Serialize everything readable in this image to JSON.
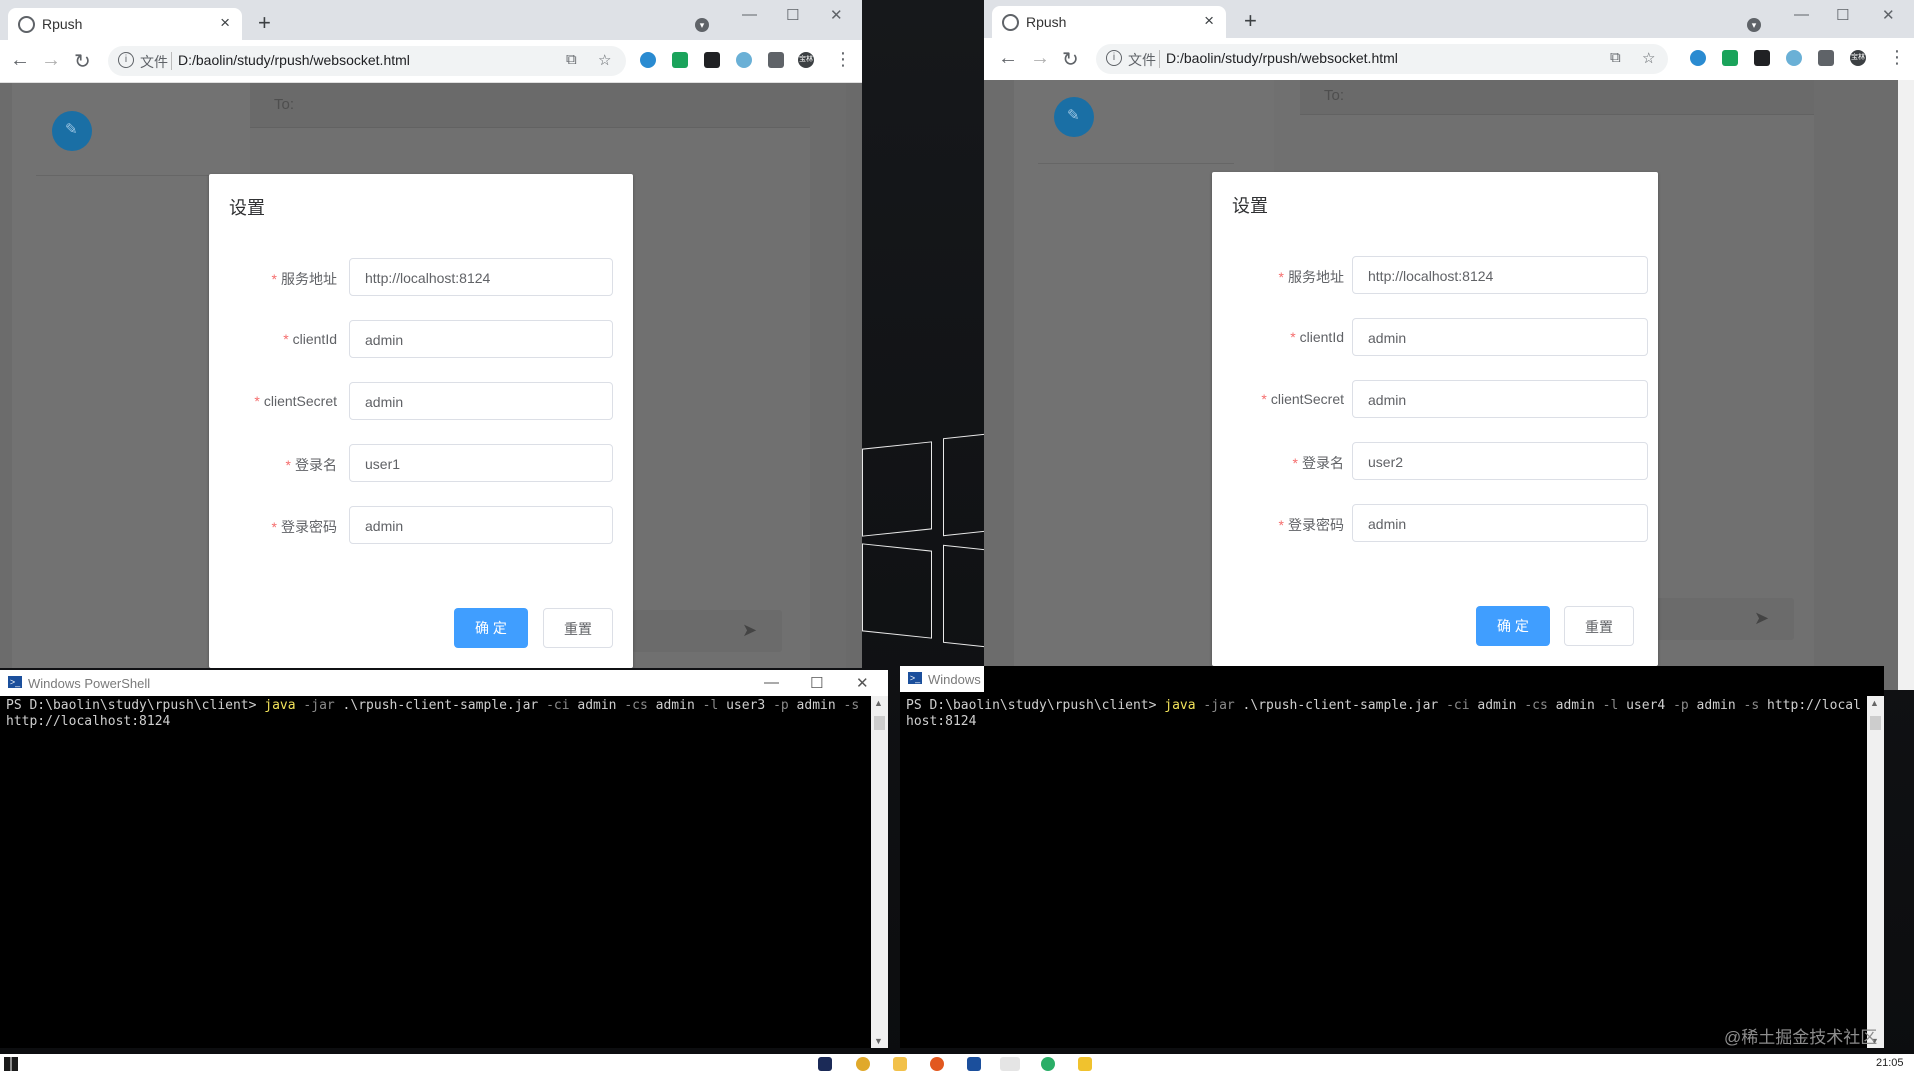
{
  "left_browser": {
    "tab_title": "Rpush",
    "omnibox_scheme_label": "文件",
    "url": "D:/baolin/study/rpush/websocket.html",
    "app": {
      "to_label": "To:"
    },
    "dialog": {
      "title": "设置",
      "fields": [
        {
          "label": "服务地址",
          "value": "http://localhost:8124"
        },
        {
          "label": "clientId",
          "value": "admin"
        },
        {
          "label": "clientSecret",
          "value": "admin"
        },
        {
          "label": "登录名",
          "value": "user1"
        },
        {
          "label": "登录密码",
          "value": "admin"
        }
      ],
      "confirm_label": "确 定",
      "reset_label": "重置"
    }
  },
  "right_browser": {
    "tab_title": "Rpush",
    "omnibox_scheme_label": "文件",
    "url": "D:/baolin/study/rpush/websocket.html",
    "app": {
      "to_label": "To:"
    },
    "dialog": {
      "title": "设置",
      "fields": [
        {
          "label": "服务地址",
          "value": "http://localhost:8124"
        },
        {
          "label": "clientId",
          "value": "admin"
        },
        {
          "label": "clientSecret",
          "value": "admin"
        },
        {
          "label": "登录名",
          "value": "user2"
        },
        {
          "label": "登录密码",
          "value": "admin"
        }
      ],
      "confirm_label": "确 定",
      "reset_label": "重置"
    }
  },
  "left_powershell": {
    "title": "Windows PowerShell",
    "prompt": "PS D:\\baolin\\study\\rpush\\client> ",
    "command_segments": [
      {
        "text": "java",
        "kind": "cmd"
      },
      {
        "text": " -jar",
        "kind": "flag"
      },
      {
        "text": " .\\rpush-client-sample.jar ",
        "kind": "arg"
      },
      {
        "text": "-ci",
        "kind": "flag"
      },
      {
        "text": " admin ",
        "kind": "arg"
      },
      {
        "text": "-cs",
        "kind": "flag"
      },
      {
        "text": " admin ",
        "kind": "arg"
      },
      {
        "text": "-l",
        "kind": "flag"
      },
      {
        "text": " user3 ",
        "kind": "arg"
      },
      {
        "text": "-p",
        "kind": "flag"
      },
      {
        "text": " admin ",
        "kind": "arg"
      },
      {
        "text": "-s",
        "kind": "flag"
      },
      {
        "text": " http://localhost:8124",
        "kind": "arg"
      }
    ]
  },
  "right_powershell": {
    "title": "Windows",
    "prompt": "PS D:\\baolin\\study\\rpush\\client> ",
    "command_segments": [
      {
        "text": "java",
        "kind": "cmd"
      },
      {
        "text": " -jar",
        "kind": "flag"
      },
      {
        "text": " .\\rpush-client-sample.jar ",
        "kind": "arg"
      },
      {
        "text": "-ci",
        "kind": "flag"
      },
      {
        "text": " admin ",
        "kind": "arg"
      },
      {
        "text": "-cs",
        "kind": "flag"
      },
      {
        "text": " admin ",
        "kind": "arg"
      },
      {
        "text": "-l",
        "kind": "flag"
      },
      {
        "text": " user4 ",
        "kind": "arg"
      },
      {
        "text": "-p",
        "kind": "flag"
      },
      {
        "text": " admin ",
        "kind": "arg"
      },
      {
        "text": "-s",
        "kind": "flag"
      },
      {
        "text": " http://localhost:8124",
        "kind": "arg"
      }
    ]
  },
  "profile_badge": "宝林",
  "taskbar": {
    "clock": "21:05"
  },
  "watermark": "@稀土掘金技术社区"
}
